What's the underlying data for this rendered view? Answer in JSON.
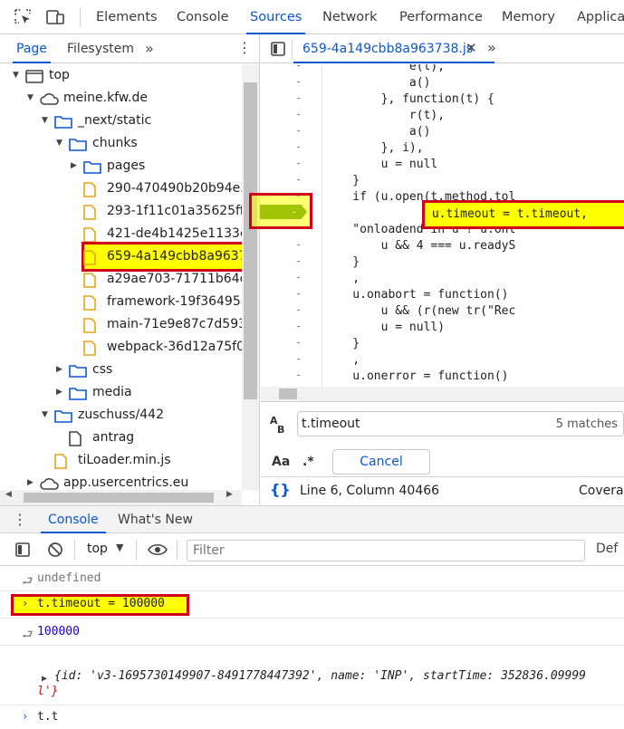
{
  "toolbar": {
    "tabs": [
      "Elements",
      "Console",
      "Sources",
      "Network",
      "Performance",
      "Memory",
      "Applica"
    ],
    "active_tab": "Sources"
  },
  "navigator": {
    "tabs": [
      "Page",
      "Filesystem"
    ],
    "tree": [
      {
        "label": "top",
        "depth": 0,
        "type": "frame",
        "expanded": true
      },
      {
        "label": "meine.kfw.de",
        "depth": 1,
        "type": "cloud",
        "expanded": true
      },
      {
        "label": "_next/static",
        "depth": 2,
        "type": "folder",
        "expanded": true
      },
      {
        "label": "chunks",
        "depth": 3,
        "type": "folder",
        "expanded": true
      },
      {
        "label": "pages",
        "depth": 4,
        "type": "folder",
        "expanded": false
      },
      {
        "label": "290-470490b20b94e35",
        "depth": 4,
        "type": "file"
      },
      {
        "label": "293-1f11c01a35625ffb",
        "depth": 4,
        "type": "file"
      },
      {
        "label": "421-de4b1425e1133c6",
        "depth": 4,
        "type": "file"
      },
      {
        "label": "659-4a149cbb8a96373",
        "depth": 4,
        "type": "file",
        "selected": true
      },
      {
        "label": "a29ae703-71711b64cf",
        "depth": 4,
        "type": "file"
      },
      {
        "label": "framework-19f3649580",
        "depth": 4,
        "type": "file"
      },
      {
        "label": "main-71e9e87c7d5930",
        "depth": 4,
        "type": "file"
      },
      {
        "label": "webpack-36d12a75f00",
        "depth": 4,
        "type": "file"
      },
      {
        "label": "css",
        "depth": 3,
        "type": "folder",
        "expanded": false
      },
      {
        "label": "media",
        "depth": 3,
        "type": "folder",
        "expanded": false
      },
      {
        "label": "zuschuss/442",
        "depth": 2,
        "type": "folder",
        "expanded": true
      },
      {
        "label": "antrag",
        "depth": 3,
        "type": "doc"
      },
      {
        "label": "tiLoader.min.js",
        "depth": 2,
        "type": "file"
      },
      {
        "label": "app.usercentrics.eu",
        "depth": 1,
        "type": "cloud",
        "expanded": false
      }
    ]
  },
  "editor": {
    "file_tab": "659-4a149cbb8a963738.js",
    "code_lines": [
      {
        "text": "            e(t),",
        "hl": false
      },
      {
        "text": "            a()",
        "hl": false
      },
      {
        "text": "        }, function(t) {",
        "hl": false
      },
      {
        "text": "            r(t),",
        "hl": false
      },
      {
        "text": "            a()",
        "hl": false
      },
      {
        "text": "        }, i),",
        "hl": false
      },
      {
        "text": "        u = null",
        "hl": false
      },
      {
        "text": "    }",
        "hl": false
      },
      {
        "text": "    if (u.open(t.method.tol",
        "hl": false
      },
      {
        "text": "    u.timeout = t.timeout,",
        "hl": true
      },
      {
        "text": "    \"onloadend\"in u ? u.onl",
        "hl": false
      },
      {
        "text": "        u && 4 === u.readyS",
        "hl": false
      },
      {
        "text": "    }",
        "hl": false
      },
      {
        "text": "    ,",
        "hl": false
      },
      {
        "text": "    u.onabort = function()",
        "hl": false
      },
      {
        "text": "        u && (r(new tr(\"Rec",
        "hl": false
      },
      {
        "text": "        u = null)",
        "hl": false
      },
      {
        "text": "    }",
        "hl": false
      },
      {
        "text": "    ,",
        "hl": false
      },
      {
        "text": "    u.onerror = function()",
        "hl": false
      }
    ],
    "gutter_marks": [
      "-",
      "-",
      "-",
      "-",
      "-",
      "-",
      "-",
      "-",
      "-",
      "-",
      "-",
      "-",
      "-",
      "-",
      "-",
      "-",
      "-",
      "-",
      "-",
      "-"
    ],
    "breakpoint_label": "-",
    "search": {
      "query": "t.timeout",
      "matches": "5 matches",
      "case_label": "Aa",
      "regex_label": ".*",
      "cancel_label": "Cancel"
    },
    "status": {
      "position": "Line 6, Column 40466",
      "coverage": "Covera"
    }
  },
  "drawer": {
    "tabs": [
      "Console",
      "What's New"
    ],
    "context": "top",
    "filter_placeholder": "Filter",
    "default_levels": "Def",
    "messages": [
      {
        "kind": "result",
        "text": "undefined"
      },
      {
        "kind": "input",
        "text": "t.timeout = 100000"
      },
      {
        "kind": "result",
        "text": "100000"
      },
      {
        "kind": "object",
        "text": "{id: 'v3-1695730149907-8491778447392', name: 'INP', startTime: 352836.09999",
        "text2": "l'}"
      },
      {
        "kind": "input",
        "text": "t.t"
      }
    ]
  },
  "colors": {
    "accent": "#0b57d0",
    "highlight": "#ffff00",
    "annotation": "#d0021b",
    "breakpoint": "#2e7d0e"
  }
}
